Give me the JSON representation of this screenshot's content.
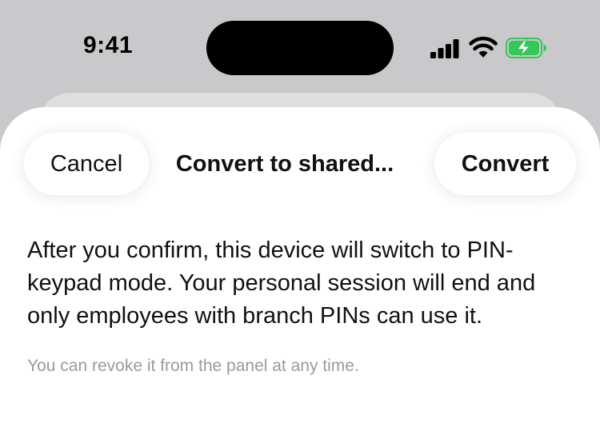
{
  "status_bar": {
    "time": "9:41",
    "icons": [
      "cellular-signal-icon",
      "wifi-icon",
      "battery-charging-icon"
    ],
    "battery_color": "#34c759"
  },
  "sheet": {
    "title": "Convert to shared...",
    "cancel_label": "Cancel",
    "confirm_label": "Convert",
    "body": "After you confirm, this device will switch to PIN-keypad mode. Your personal session will end and only employees with branch PINs can use it.",
    "hint": "You can revoke it from the panel at any time."
  }
}
